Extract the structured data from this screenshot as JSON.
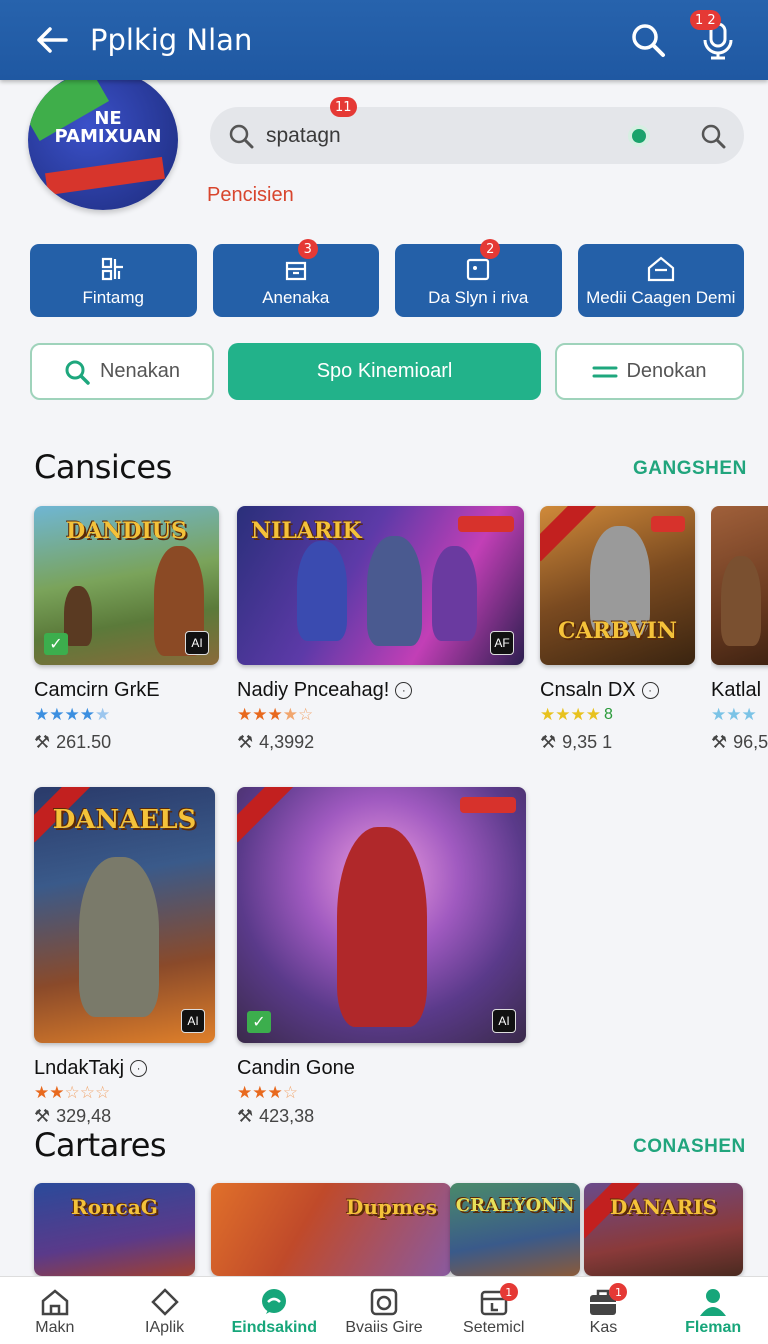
{
  "appbar": {
    "title": "Pplkig Nlan",
    "notif_badge": "1 2"
  },
  "header": {
    "logo_text": "NE PAMIXUAN",
    "search_value": "spatagn",
    "search_badge": "11",
    "subtitle": "Pencisien"
  },
  "tiles": [
    {
      "label": "Fintamg",
      "icon": "grid-icon",
      "badge": ""
    },
    {
      "label": "Anenaka",
      "icon": "box-icon",
      "badge": "3"
    },
    {
      "label": "Da Slyn i riva",
      "icon": "tablet-icon",
      "badge": "2"
    },
    {
      "label": "Medii Caagen Demi",
      "icon": "home-icon",
      "badge": ""
    }
  ],
  "filters": {
    "left": "Nenakan",
    "middle": "Spo Kinemioarl",
    "right": "Denokan"
  },
  "section1": {
    "title": "Cansices",
    "link": "GANGSHEN",
    "cards": [
      {
        "name": "Camcirn GrkE",
        "stars": 4,
        "downloads": "261.50",
        "art": "DANDIUS",
        "star_color": "#3c8fe0"
      },
      {
        "name": "Nadiy Pnceahag!",
        "stars": 3.5,
        "downloads": "4,3992",
        "art": "NILARIK",
        "star_color": "#e8691e"
      },
      {
        "name": "Cnsaln DX",
        "stars": 4,
        "downloads": "9,35  1",
        "art": "CARBVIN",
        "star_color": "#e8c21e",
        "extra": "8"
      },
      {
        "name": "Katlal",
        "stars": 3,
        "downloads": "96,5",
        "art": "",
        "star_color": "#7bc3e6"
      }
    ],
    "row2": [
      {
        "name": "LndakTakj",
        "stars": 2.5,
        "downloads": "329,48",
        "art": "DANAELS",
        "star_color": "#e8691e"
      },
      {
        "name": "Candin Gone",
        "stars": 3,
        "downloads": "423,38",
        "art": "",
        "star_color": "#e8691e"
      }
    ]
  },
  "section2": {
    "title": "Cartares",
    "link": "CONASHEN",
    "thumbs": [
      "RoncaG",
      "Dupmes",
      "CRAEYONN",
      "DANARIS"
    ]
  },
  "bottomnav": [
    {
      "label": "Makn",
      "icon": "home-icon",
      "badge": "",
      "active": false
    },
    {
      "label": "IAplik",
      "icon": "tag-icon",
      "badge": "",
      "active": false
    },
    {
      "label": "Eindsakind",
      "icon": "chat-icon",
      "badge": "",
      "active": true
    },
    {
      "label": "Bvaiis Gire",
      "icon": "camera-icon",
      "badge": "",
      "active": false
    },
    {
      "label": "Setemicl",
      "icon": "calendar-icon",
      "badge": "1",
      "active": false
    },
    {
      "label": "Kas",
      "icon": "briefcase-icon",
      "badge": "1",
      "active": false
    },
    {
      "label": "Fleman",
      "icon": "person-icon",
      "badge": "",
      "active": true
    }
  ],
  "colors": {
    "primary": "#2460a8",
    "accent": "#22b28a",
    "subtitle": "#d8452d"
  }
}
